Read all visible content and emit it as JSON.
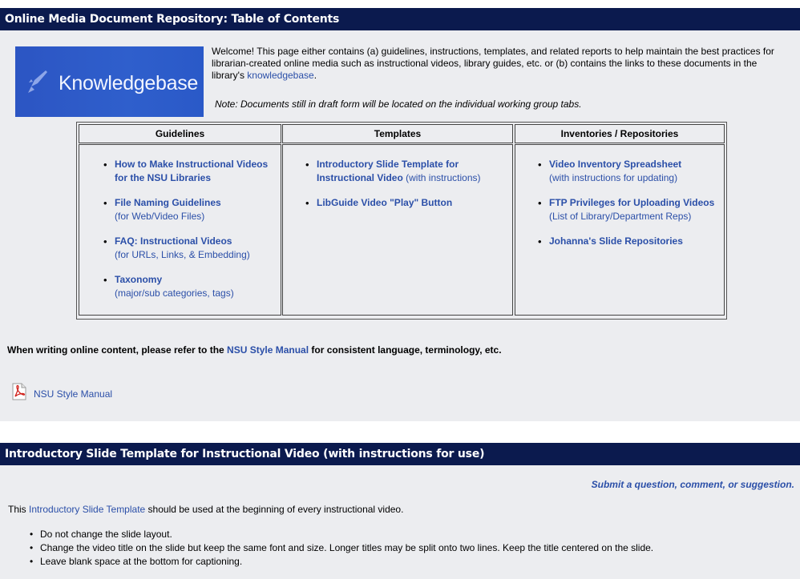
{
  "section1": {
    "title": "Online Media Document Repository: Table of Contents",
    "banner_text": "Knowledgebase",
    "welcome_before": "Welcome!  This page either contains (a) guidelines, instructions, templates, and related reports to help maintain the best practices for librarian-created online media such as instructional videos, library guides, etc. or (b) contains the links to these documents in the library's ",
    "welcome_link": "knowledgebase",
    "welcome_after": ".",
    "note": "Note: Documents still in draft form will be located on the individual working group tabs.",
    "columns": [
      {
        "header": "Guidelines",
        "items": [
          {
            "link": "How to Make Instructional Videos for the NSU Libraries",
            "sub": ""
          },
          {
            "link": "File Naming Guidelines",
            "sub": "(for Web/Video Files)"
          },
          {
            "link": "FAQ: Instructional Videos",
            "sub": "(for URLs, Links, & Embedding)"
          },
          {
            "link": "Taxonomy",
            "sub": "(major/sub categories, tags)"
          }
        ]
      },
      {
        "header": "Templates",
        "items": [
          {
            "link": "Introductory Slide Template for Instructional Video",
            "sub": " (with instructions)"
          },
          {
            "link": "LibGuide Video \"Play\" Button",
            "sub": ""
          }
        ]
      },
      {
        "header": "Inventories / Repositories",
        "items": [
          {
            "link": "Video Inventory Spreadsheet",
            "sub": "(with instructions for updating)"
          },
          {
            "link": "FTP Privileges for Uploading Videos",
            "sub": "(List of Library/Department Reps)"
          },
          {
            "link": "Johanna's Slide Repositories",
            "sub": ""
          }
        ]
      }
    ],
    "refer_before": "When writing online content, please refer to the ",
    "refer_link": "NSU Style Manual",
    "refer_after": " for consistent language, terminology, etc.",
    "pdf_link": "NSU Style Manual",
    "pdf_icon": "pdf-file-icon"
  },
  "section2": {
    "title": "Introductory Slide Template for Instructional Video (with instructions for use)",
    "submit": "Submit a question, comment, or suggestion.",
    "intro_before": "This ",
    "intro_link": "Introductory Slide Template",
    "intro_after": " should be used at the beginning of every instructional video.",
    "bullets": [
      "Do not change the slide layout.",
      "Change the video title on the slide but keep the same font and size.  Longer titles may be split onto two lines.  Keep the title centered on the slide.",
      "Leave blank space at the bottom for captioning."
    ]
  },
  "colors": {
    "header_bg": "#0b1a4e",
    "link": "#2b4fa8",
    "panel_bg": "#ecedf0",
    "banner_bg": "#2c55c3"
  }
}
